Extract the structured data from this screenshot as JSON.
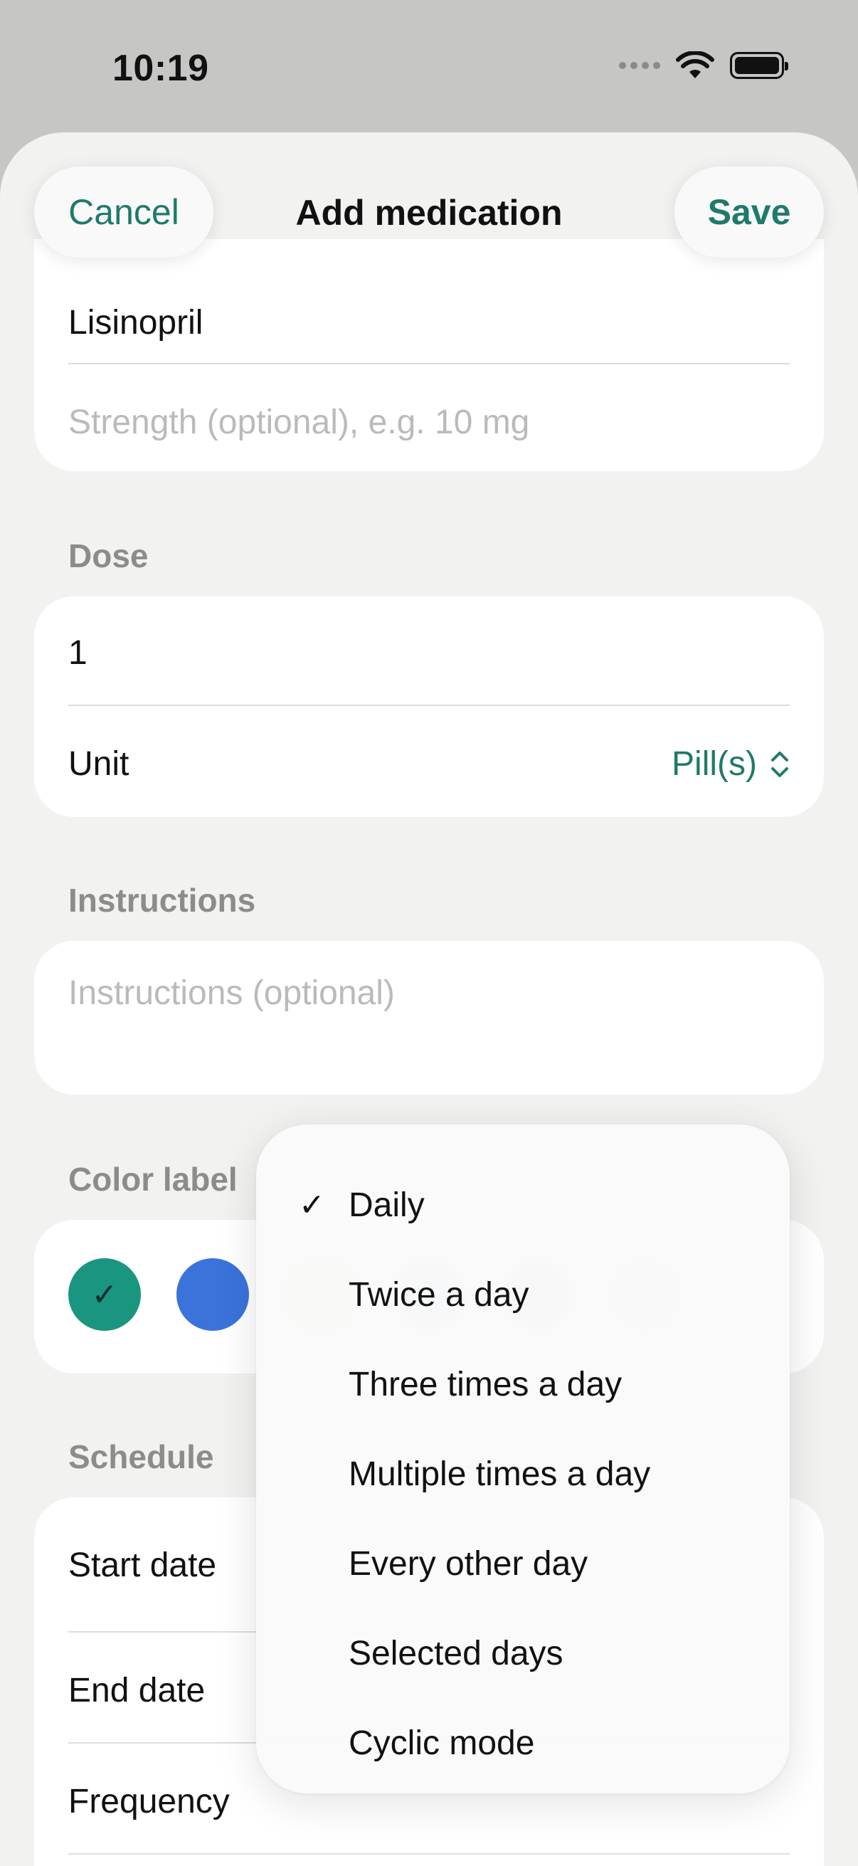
{
  "status_bar": {
    "time": "10:19"
  },
  "nav": {
    "cancel_label": "Cancel",
    "title": "Add medication",
    "save_label": "Save",
    "ghost_header": "on"
  },
  "medication": {
    "name_value": "Lisinopril",
    "strength_placeholder": "Strength (optional), e.g. 10 mg"
  },
  "dose": {
    "section_label": "Dose",
    "amount_value": "1",
    "unit_label": "Unit",
    "unit_value": "Pill(s)"
  },
  "instructions": {
    "section_label": "Instructions",
    "placeholder": "Instructions (optional)"
  },
  "color_label": {
    "section_label": "Color label",
    "colors": [
      "#1a9580",
      "#3b73db",
      "#f5a35e",
      "#9b7cf2",
      "#f27cad",
      "#9ea3a8"
    ],
    "selected_index": 0
  },
  "schedule": {
    "section_label": "Schedule",
    "start_date_label": "Start date",
    "end_date_label": "End date",
    "frequency_label": "Frequency"
  },
  "frequency_menu": {
    "selected_index": 0,
    "items": [
      "Daily",
      "Twice a day",
      "Three times a day",
      "Multiple times a day",
      "Every other day",
      "Selected days",
      "Cyclic mode"
    ]
  }
}
